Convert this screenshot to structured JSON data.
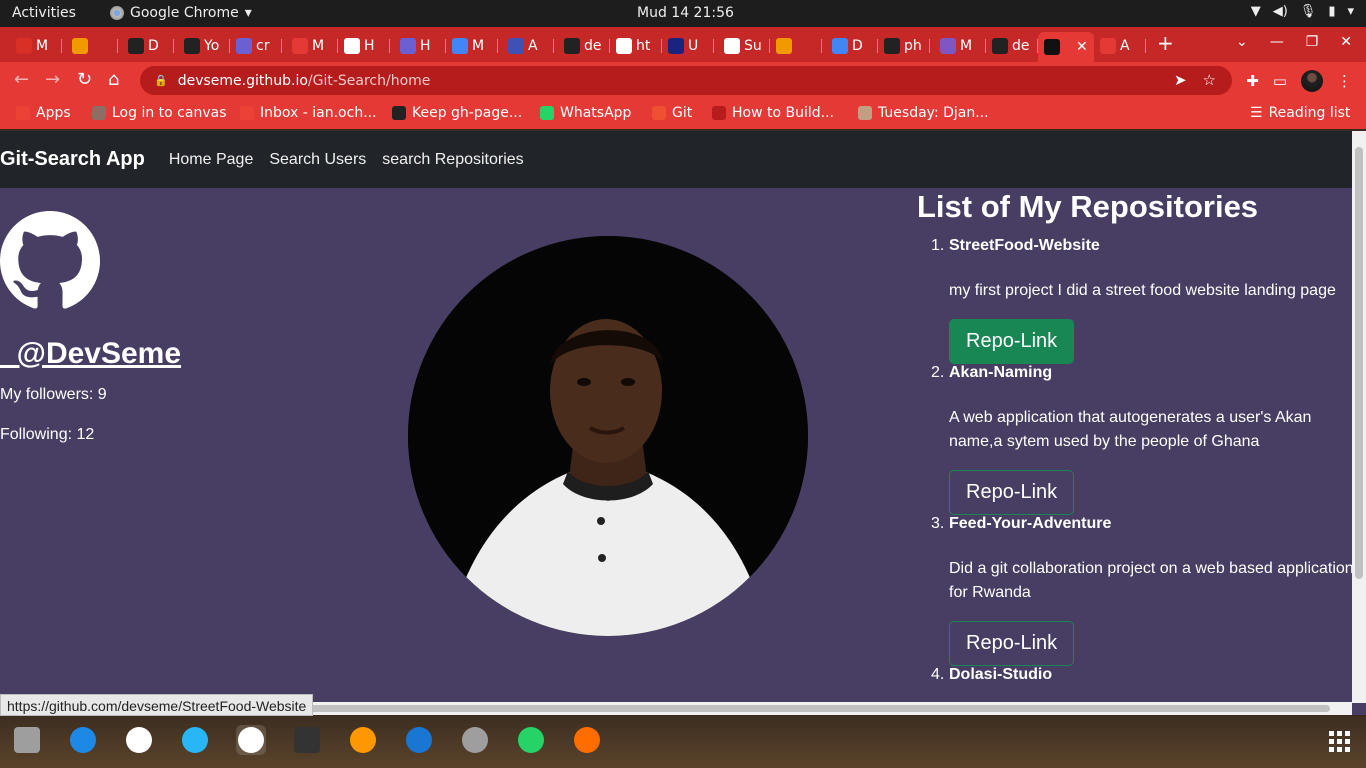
{
  "system": {
    "activities": "Activities",
    "app_name": "Google Chrome",
    "clock": "Mud 14  21:56"
  },
  "tabs": [
    {
      "label": "M",
      "color": "#d93025"
    },
    {
      "label": "",
      "color": "#f29900"
    },
    {
      "label": "D",
      "color": "#222222"
    },
    {
      "label": "Yo",
      "color": "#222222"
    },
    {
      "label": "cr",
      "color": "#6b5fd4"
    },
    {
      "label": "M",
      "color": "#e53935"
    },
    {
      "label": "H",
      "color": "#ffffff"
    },
    {
      "label": "H",
      "color": "#6b5fd4"
    },
    {
      "label": "M",
      "color": "#4285f4"
    },
    {
      "label": "A",
      "color": "#3f51b5"
    },
    {
      "label": "de",
      "color": "#222222"
    },
    {
      "label": "ht",
      "color": "#ffffff"
    },
    {
      "label": "U",
      "color": "#1a237e"
    },
    {
      "label": "Su",
      "color": "#ffffff"
    },
    {
      "label": "",
      "color": "#f29900"
    },
    {
      "label": "D",
      "color": "#4285f4"
    },
    {
      "label": "ph",
      "color": "#222222"
    },
    {
      "label": "M",
      "color": "#7e57c2"
    },
    {
      "label": "de",
      "color": "#222222"
    },
    {
      "label": "",
      "color": "#111111",
      "active": true
    },
    {
      "label": "A",
      "color": "#e53935"
    }
  ],
  "url": {
    "host": "devseme.github.io",
    "path": "/Git-Search/home"
  },
  "bookmarks": [
    {
      "label": "Apps",
      "color": "#ea4335"
    },
    {
      "label": "Log in to canvas",
      "color": "#8d6e63"
    },
    {
      "label": "Inbox - ian.och...",
      "color": "#ea4335"
    },
    {
      "label": "Keep gh-page...",
      "color": "#222222"
    },
    {
      "label": "WhatsApp",
      "color": "#25d366"
    },
    {
      "label": "Git",
      "color": "#f05032"
    },
    {
      "label": "How to Build...",
      "color": "#b71c1c"
    },
    {
      "label": "Tuesday: Djan...",
      "color": "#c0a080"
    }
  ],
  "reading_list": "Reading list",
  "site": {
    "brand": "Git-Search App",
    "nav": [
      "Home Page",
      "Search Users",
      "search Repositories"
    ],
    "username": "_@DevSeme",
    "followers": "My followers: 9",
    "following": "Following: 12",
    "repos_title": "List of My Repositories",
    "repos": [
      {
        "num": "1.",
        "name": "StreetFood-Website",
        "desc": "my first project I did a street food website landing page",
        "button": "Repo-Link",
        "hovered": true
      },
      {
        "num": "2.",
        "name": "Akan-Naming",
        "desc": "A web application that autogenerates a user's Akan name,a sytem used by the people of Ghana",
        "button": "Repo-Link",
        "hovered": false
      },
      {
        "num": "3.",
        "name": "Feed-Your-Adventure",
        "desc": "Did a git collaboration project on a web based application for Rwanda",
        "button": "Repo-Link",
        "hovered": false
      },
      {
        "num": "4.",
        "name": "Dolasi-Studio",
        "desc": "",
        "button": "",
        "hovered": false
      }
    ]
  },
  "status_url": "https://github.com/devseme/StreetFood-Website",
  "colors": {
    "tabstrip": "#c62828",
    "toolbar": "#e53935",
    "page_bg": "#483d63",
    "navbar": "#212529",
    "button_green": "#198754"
  },
  "dock": [
    "files-icon",
    "text-editor-icon",
    "slack-icon",
    "telegram-icon",
    "chrome-icon",
    "terminal-icon",
    "vlc-icon",
    "vscode-icon",
    "settings-icon",
    "whatsapp-icon",
    "postman-icon"
  ]
}
